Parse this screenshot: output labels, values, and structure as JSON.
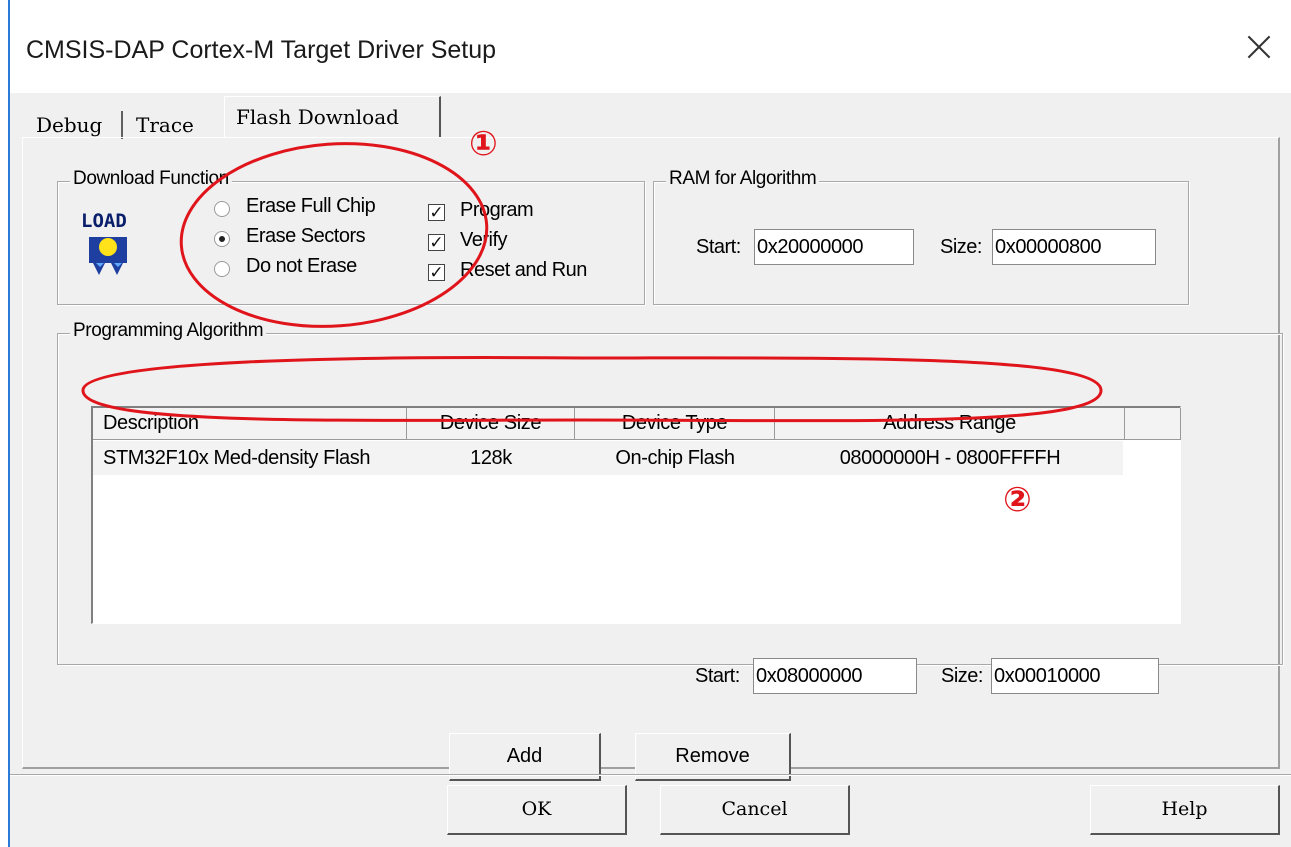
{
  "window": {
    "title": "CMSIS-DAP Cortex-M Target Driver Setup"
  },
  "tabs": [
    {
      "label": "Debug"
    },
    {
      "label": "Trace"
    },
    {
      "label": "Flash Download"
    }
  ],
  "download_function": {
    "title": "Download Function",
    "icon": "LOAD",
    "radios": [
      {
        "label": "Erase Full Chip",
        "selected": false
      },
      {
        "label": "Erase Sectors",
        "selected": true
      },
      {
        "label": "Do not Erase",
        "selected": false
      }
    ],
    "checkboxes": [
      {
        "label": "Program",
        "checked": true
      },
      {
        "label": "Verify",
        "checked": true
      },
      {
        "label": "Reset and Run",
        "checked": true
      }
    ]
  },
  "ram": {
    "title": "RAM for Algorithm",
    "start_label": "Start:",
    "start": "0x20000000",
    "size_label": "Size:",
    "size": "0x00000800"
  },
  "programming": {
    "title": "Programming Algorithm",
    "columns": [
      "Description",
      "Device Size",
      "Device Type",
      "Address Range"
    ],
    "rows": [
      {
        "description": "STM32F10x Med-density Flash",
        "size": "128k",
        "type": "On-chip Flash",
        "range": "08000000H - 0800FFFFH"
      }
    ],
    "start_label": "Start:",
    "start": "0x08000000",
    "size_label": "Size:",
    "size": "0x00010000",
    "add": "Add",
    "remove": "Remove"
  },
  "footer": {
    "ok": "OK",
    "cancel": "Cancel",
    "help": "Help"
  },
  "annotations": {
    "one": "①",
    "two": "②",
    "color": "#e0151b"
  }
}
